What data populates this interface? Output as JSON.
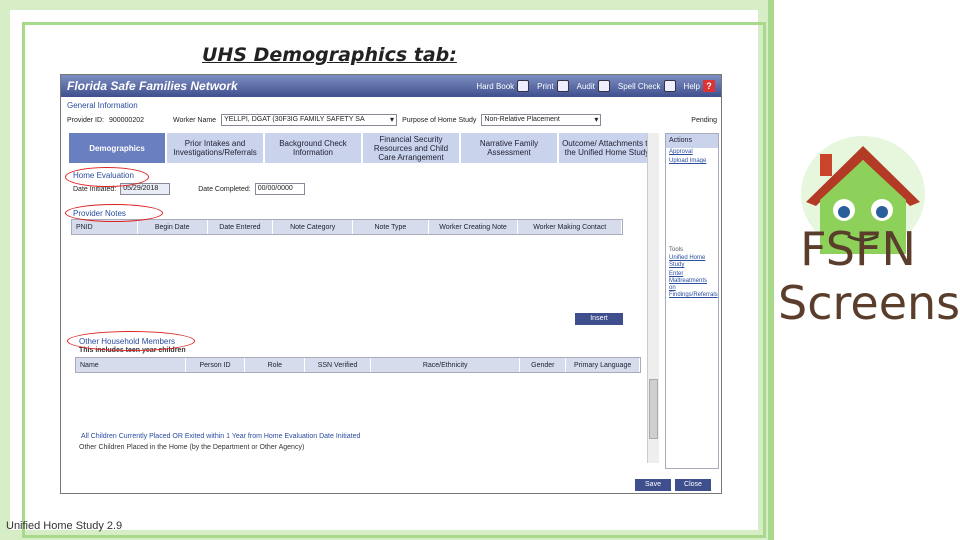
{
  "slide": {
    "title": "UHS Demographics tab",
    "colon": ":",
    "side_title": "FSFN Screens",
    "footer": "Unified Home Study 2.9"
  },
  "app": {
    "brand": "Florida Safe Families Network",
    "toolbar": [
      {
        "label": "Hard Book",
        "icon": "pencil-icon"
      },
      {
        "label": "Print",
        "icon": "printer-icon"
      },
      {
        "label": "Audit",
        "icon": "audit-icon"
      },
      {
        "label": "Spell Check",
        "icon": "spellcheck-icon"
      },
      {
        "label": "Help",
        "icon": "help-icon"
      }
    ],
    "general_information_label": "General Information",
    "provider_id_label": "Provider ID:",
    "provider_id": "900000202",
    "worker_name_label": "Worker Name",
    "worker_name": "YELLPI, DGAT (30F3IG FAMILY SAFETY SA",
    "purpose_label": "Purpose of Home Study",
    "purpose": "Non-Relative Placement",
    "status": "Pending",
    "tabs": [
      {
        "label": "Demographics",
        "active": true
      },
      {
        "label": "Prior Intakes and Investigations/Referrals",
        "active": false
      },
      {
        "label": "Background Check Information",
        "active": false
      },
      {
        "label": "Financial Security Resources and Child Care Arrangement",
        "active": false
      },
      {
        "label": "Narrative Family Assessment",
        "active": false
      },
      {
        "label": "Outcome/ Attachments to the Unified Home Study",
        "active": false
      }
    ],
    "home_evaluation_label": "Home Evaluation",
    "date_initiated_label": "Date Initiated:",
    "date_initiated": "05/29/2018",
    "date_completed_label": "Date Completed:",
    "date_completed": "00/00/0000",
    "provider_notes_label": "Provider Notes",
    "provider_notes_columns": [
      "PNID",
      "Begin Date",
      "Date Entered",
      "Note Category",
      "Note Type",
      "Worker Creating Note",
      "Worker Making Contact"
    ],
    "insert_label": "Insert",
    "other_household_label": "Other Household Members",
    "household_note": "This includes teen year children",
    "household_columns": [
      "Name",
      "Person ID",
      "Role",
      "SSN Verified",
      "Race/Ethnicity",
      "Gender",
      "Primary Language"
    ],
    "children_placed_label": "All Children Currently Placed OR Exited within 1 Year from Home Evaluation Date Initiated",
    "other_children_label": "Other Children Placed in the Home (by the Department or Other Agency)",
    "side_panel": {
      "actions_label": "Actions",
      "action_links": [
        "Approval",
        "Upload Image"
      ],
      "tools_label": "Tools",
      "tool_links": [
        "Unified Home Study",
        "Enter Maltreatments on Findings/Referrals"
      ]
    },
    "save_label": "Save",
    "close_label": "Close"
  }
}
